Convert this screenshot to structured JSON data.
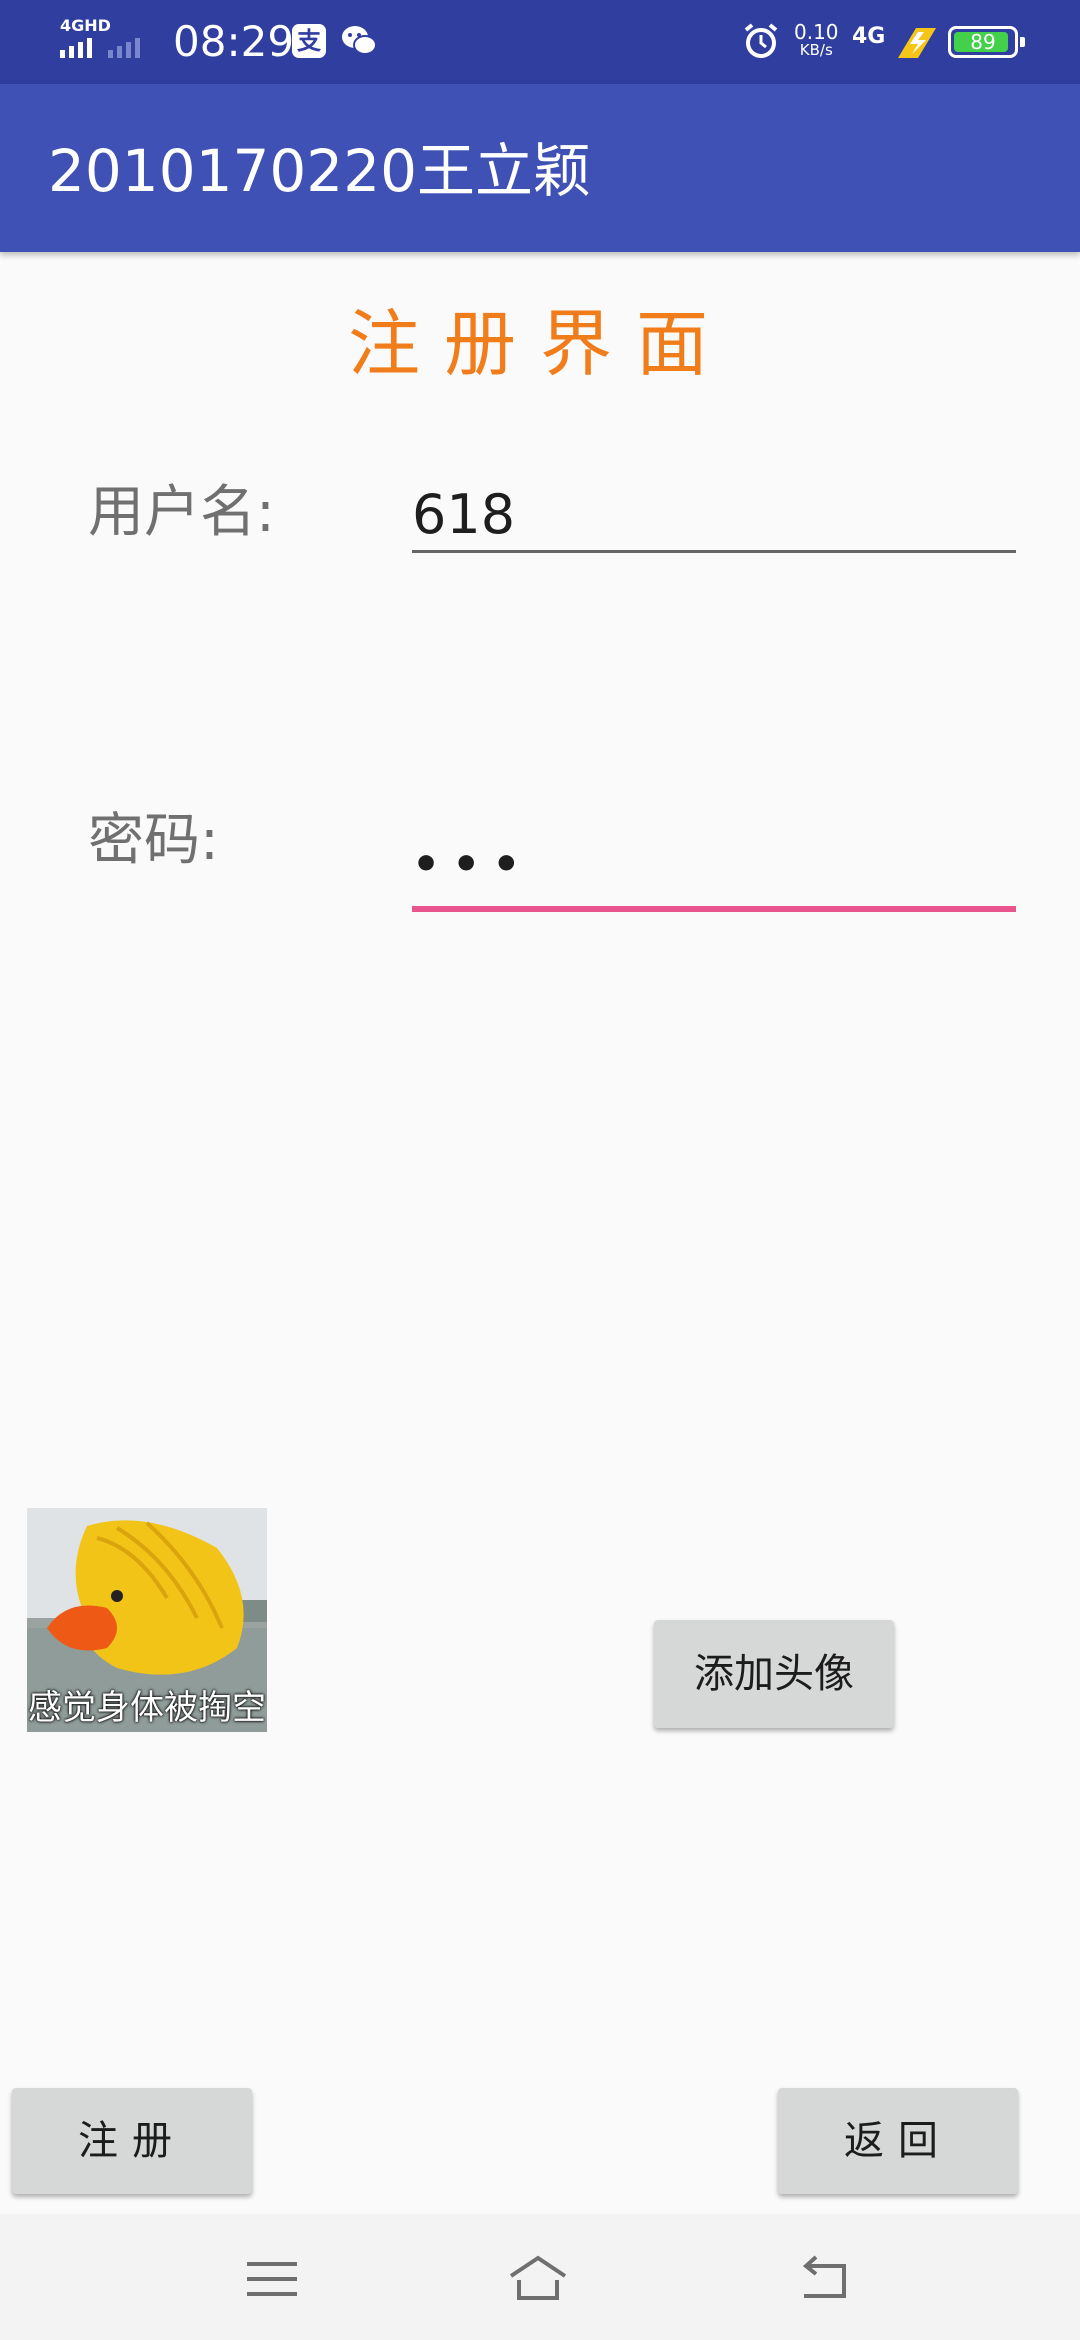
{
  "status_bar": {
    "network_label": "4GHD",
    "time": "08:29",
    "notification_icons": [
      "alipay-icon",
      "wechat-icon"
    ],
    "alarm_icon": "alarm-icon",
    "speed_value": "0.10",
    "speed_unit": "KB/s",
    "network2": "4G",
    "battery_level": "89",
    "colors": {
      "background": "#303f9f",
      "battery": "#43d04a"
    }
  },
  "app_bar": {
    "title": "2010170220王立颖",
    "color": "#3f51b5"
  },
  "form": {
    "title": "注册界面",
    "title_color": "#f07c1a",
    "username_label": "用户名:",
    "username_value": "618",
    "password_label": "密码:",
    "password_masked": "•••",
    "focus_underline_color": "#e8558c"
  },
  "avatar": {
    "caption": "感觉身体被掏空"
  },
  "buttons": {
    "add_avatar": "添加头像",
    "register": "注册",
    "back": "返回"
  },
  "nav_bar": {
    "icons": [
      "menu-icon",
      "home-icon",
      "back-icon"
    ]
  }
}
